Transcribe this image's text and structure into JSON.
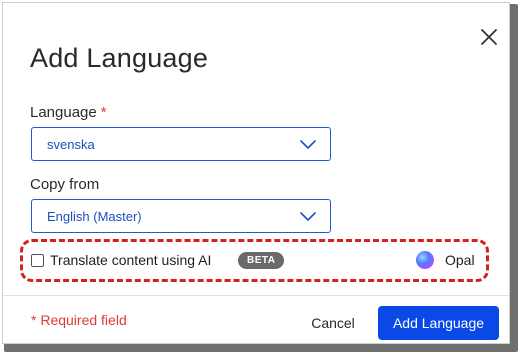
{
  "dialog": {
    "title": "Add Language",
    "close_icon": "close-icon"
  },
  "language_field": {
    "label": "Language",
    "required_marker": "*",
    "value": "svenska"
  },
  "copy_from_field": {
    "label": "Copy from",
    "value": "English (Master)"
  },
  "translate_option": {
    "label": "Translate content using AI",
    "checked": false,
    "badge": "BETA",
    "provider_label": "Opal",
    "provider_icon": "opal-icon"
  },
  "footer": {
    "required_note": "* Required field",
    "cancel_label": "Cancel",
    "add_label": "Add Language"
  },
  "colors": {
    "accent": "#0a49e6",
    "select_border": "#1e5bd6",
    "required": "#e03a3a",
    "highlight": "#d42020",
    "badge": "#6a6a6a"
  }
}
